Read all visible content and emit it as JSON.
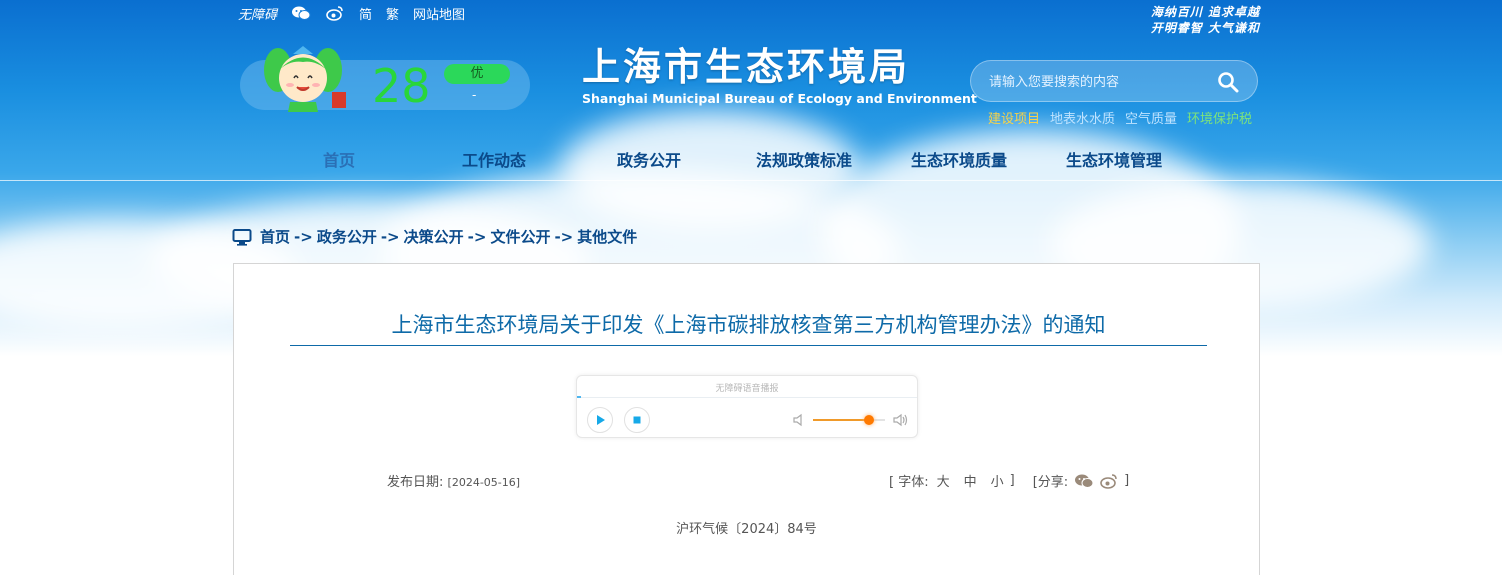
{
  "topbar": {
    "accessibility": "无障碍",
    "simplified": "简",
    "traditional": "繁",
    "sitemap": "网站地图"
  },
  "slogan": {
    "line1": "海纳百川  追求卓越",
    "line2": "开明睿智  大气谦和"
  },
  "weather": {
    "temperature": "28",
    "aqi_label": "优",
    "aqi_sub": "-"
  },
  "logo": {
    "cn": "上海市生态环境局",
    "en": "Shanghai Municipal Bureau of Ecology and Environment"
  },
  "search": {
    "placeholder": "请输入您要搜索的内容"
  },
  "quick_links": [
    {
      "label": "建设项目",
      "color": "#f6d24a"
    },
    {
      "label": "地表水水质",
      "color": "#bfe3ff"
    },
    {
      "label": "空气质量",
      "color": "#bfe3ff"
    },
    {
      "label": "环境保护税",
      "color": "#7ee37a"
    }
  ],
  "nav": {
    "items": [
      "首页",
      "工作动态",
      "政务公开",
      "法规政策标准",
      "生态环境质量",
      "生态环境管理"
    ]
  },
  "breadcrumb": {
    "items": [
      "首页",
      "政务公开",
      "决策公开",
      "文件公开",
      "其他文件"
    ],
    "separator": "->"
  },
  "article": {
    "title": "上海市生态环境局关于印发《上海市碳排放核查第三方机构管理办法》的通知",
    "player_title": "无障碍语音播报",
    "publish_label": "发布日期:",
    "publish_date": "[2024-05-16]",
    "font_label": "[ 字体:",
    "font_large": "大",
    "font_medium": "中",
    "font_small": "小",
    "font_close": "]",
    "share_label": "[分享:",
    "share_close": "]",
    "doc_number": "沪环气候〔2024〕84号"
  },
  "player": {
    "volume": 0.78
  },
  "colors": {
    "accent": "#0e6aa8",
    "nav_text": "#0b4a8a",
    "temp": "#29d63a"
  }
}
